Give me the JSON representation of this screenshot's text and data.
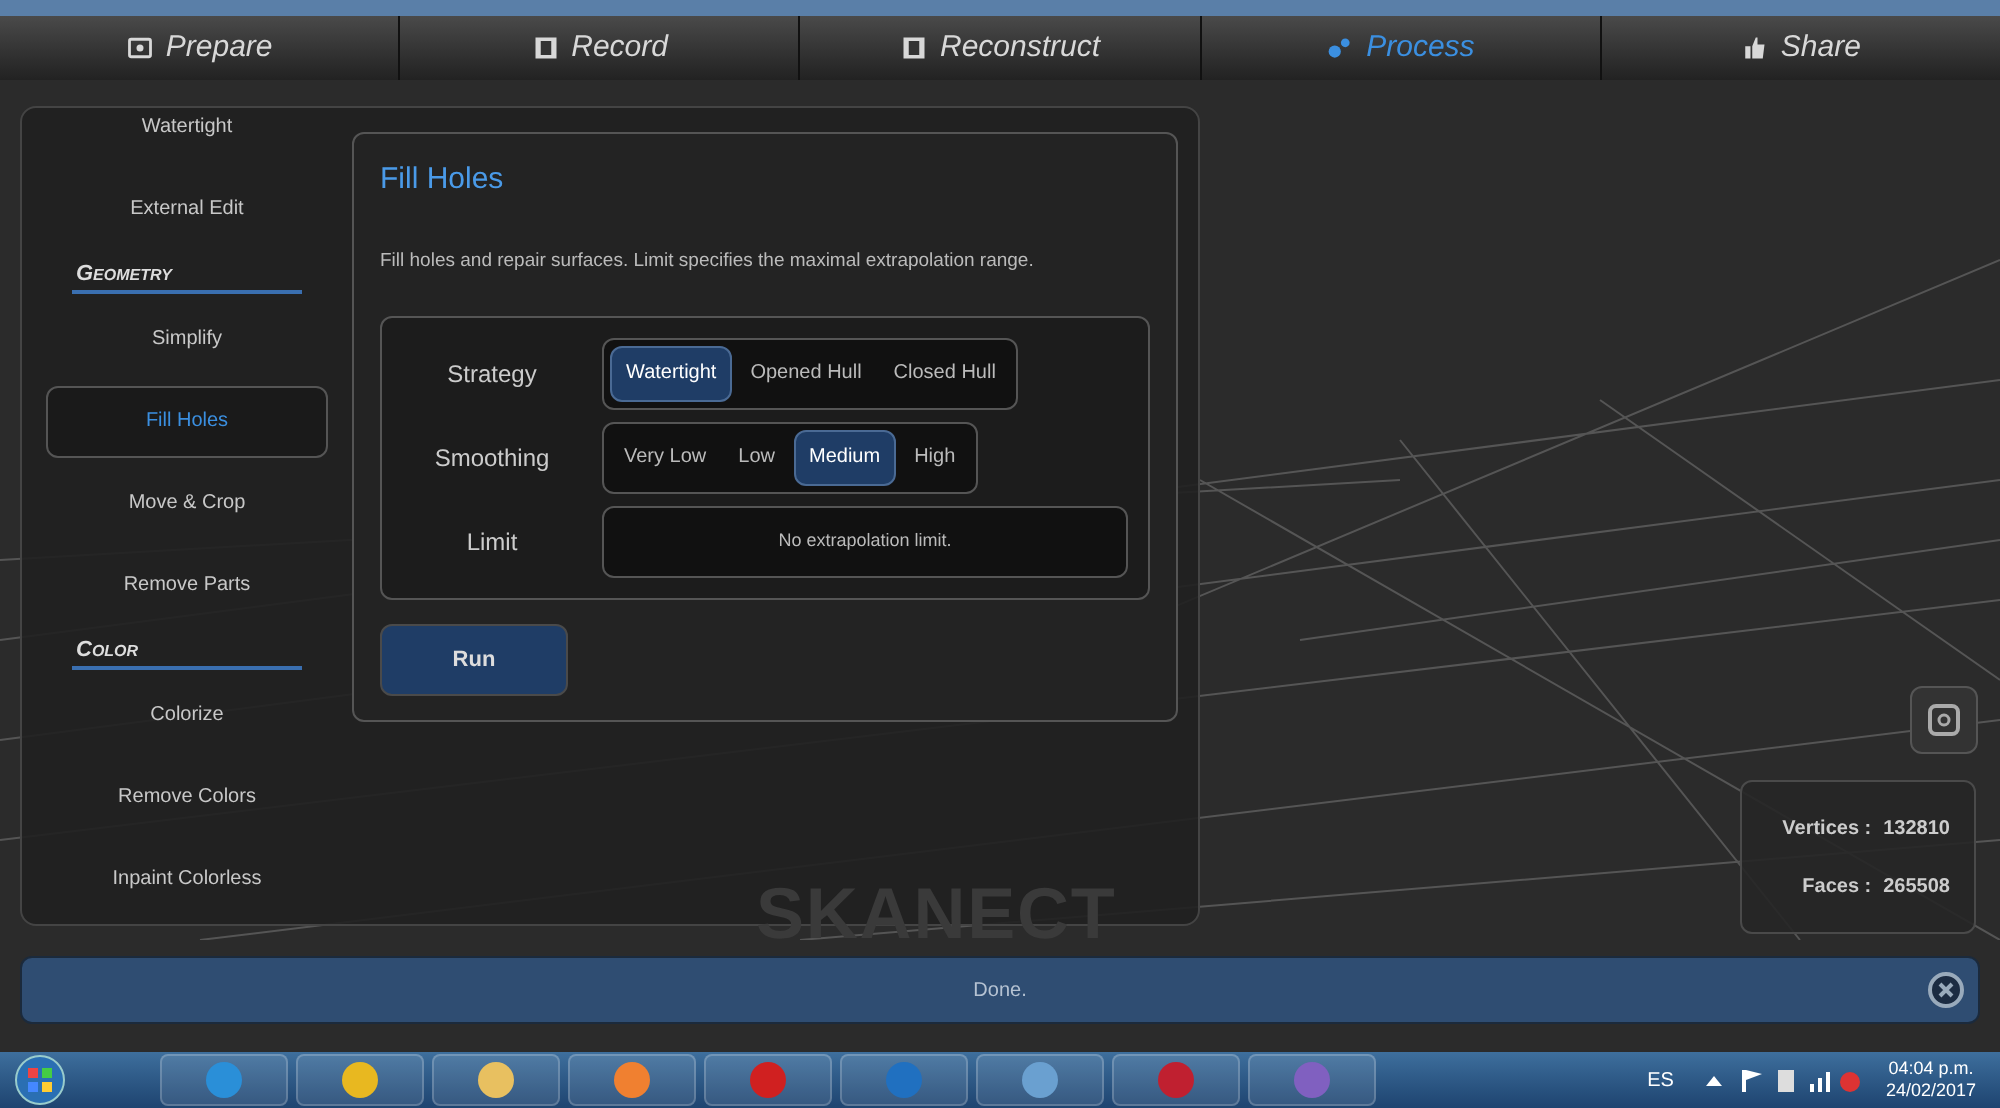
{
  "steps": [
    {
      "label": "Prepare",
      "selected": false
    },
    {
      "label": "Record",
      "selected": false
    },
    {
      "label": "Reconstruct",
      "selected": false
    },
    {
      "label": "Process",
      "selected": true
    },
    {
      "label": "Share",
      "selected": false
    }
  ],
  "sidebar": {
    "items": [
      {
        "kind": "item",
        "label": "Watertight",
        "selected": false
      },
      {
        "kind": "item",
        "label": "External Edit",
        "selected": false
      },
      {
        "kind": "heading",
        "label": "Geometry"
      },
      {
        "kind": "item",
        "label": "Simplify",
        "selected": false
      },
      {
        "kind": "item",
        "label": "Fill Holes",
        "selected": true
      },
      {
        "kind": "item",
        "label": "Move & Crop",
        "selected": false
      },
      {
        "kind": "item",
        "label": "Remove Parts",
        "selected": false
      },
      {
        "kind": "heading",
        "label": "Color"
      },
      {
        "kind": "item",
        "label": "Colorize",
        "selected": false
      },
      {
        "kind": "item",
        "label": "Remove Colors",
        "selected": false
      },
      {
        "kind": "item",
        "label": "Inpaint Colorless",
        "selected": false
      }
    ]
  },
  "panel": {
    "title": "Fill Holes",
    "description": "Fill holes and repair surfaces. Limit specifies the maximal extrapolation range.",
    "options": [
      {
        "kind": "choice",
        "label": "Strategy",
        "choices": [
          {
            "label": "Watertight",
            "selected": true
          },
          {
            "label": "Opened Hull",
            "selected": false
          },
          {
            "label": "Closed Hull",
            "selected": false
          }
        ]
      },
      {
        "kind": "choice",
        "label": "Smoothing",
        "choices": [
          {
            "label": "Very Low",
            "selected": false
          },
          {
            "label": "Low",
            "selected": false
          },
          {
            "label": "Medium",
            "selected": true
          },
          {
            "label": "High",
            "selected": false
          }
        ]
      },
      {
        "kind": "field",
        "label": "Limit",
        "value": "No extrapolation limit."
      }
    ],
    "run_button": "Run"
  },
  "viewport": {
    "logo": "SKANECT",
    "stats": [
      {
        "label": "Vertices :",
        "value": "132810"
      },
      {
        "label": "Faces :",
        "value": "265508"
      }
    ]
  },
  "status_bar": {
    "message": "Done."
  },
  "taskbar": {
    "language": "ES",
    "time": "04:04 p.m.",
    "date": "24/02/2017"
  }
}
